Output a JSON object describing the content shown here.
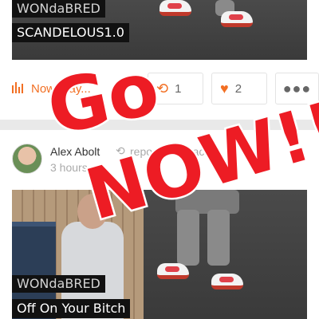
{
  "top_post": {
    "artist": "WONdaBRED",
    "title": "SCANDELOUS1.0",
    "actions": {
      "play_label": "Now Play...",
      "repost_count": "1",
      "like_count": "2"
    }
  },
  "bottom_post": {
    "poster_name": "Alex Abolt",
    "repost_label": "reposted a track",
    "time_ago": "3 hours",
    "artist": "WONdaBRED",
    "title": "Off On Your Bitch"
  },
  "overlay": {
    "line1": "Go",
    "line2": "NOW!!"
  },
  "colors": {
    "accent": "#f26f23",
    "overlay": "#ed1c24"
  },
  "icons": {
    "play": "waveform-icon",
    "repost": "repost-icon",
    "like": "heart-icon",
    "more": "more-icon"
  }
}
